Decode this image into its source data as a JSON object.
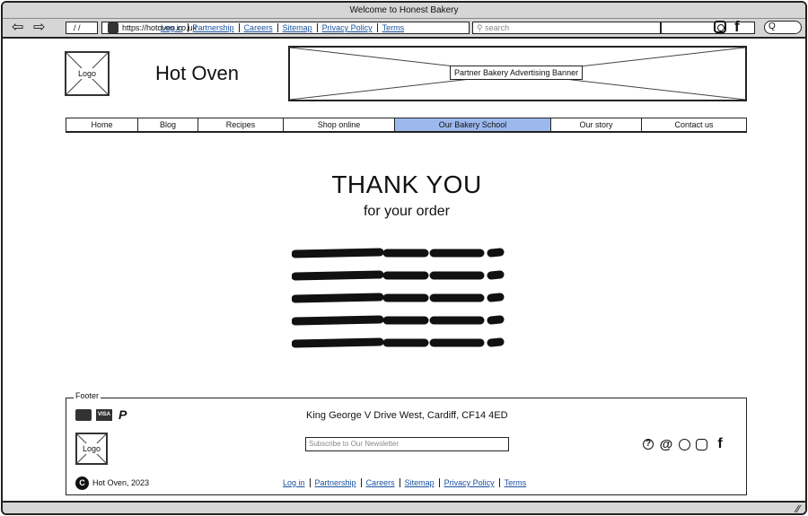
{
  "window": {
    "title": "Welcome to Honest Bakery"
  },
  "toolbar": {
    "back_icon": "back-arrow-icon",
    "forward_icon": "forward-arrow-icon",
    "path": "/ /",
    "url": "https://hotoven.co.uk",
    "links": [
      "Log in",
      "Partnership",
      "Careers",
      "Sitemap",
      "Privacy Policy",
      "Terms"
    ],
    "search_placeholder": "search",
    "search_pill": "Q"
  },
  "header": {
    "logo_label": "Logo",
    "brand": "Hot Oven",
    "banner_label": "Partner Bakery Advertising Banner"
  },
  "nav": {
    "items": [
      "Home",
      "Blog",
      "Recipes",
      "Shop online",
      "Our Bakery School",
      "Our story",
      "Contact us"
    ],
    "active": "Our Bakery School",
    "active_color": "#9db8ec"
  },
  "main": {
    "title": "THANK YOU",
    "subtitle": "for your order",
    "scribble_lines": 5
  },
  "footer": {
    "legend": "Footer",
    "payments": [
      "mastercard-icon",
      "visa-icon",
      "paypal-icon"
    ],
    "visa_label": "VISA",
    "address": "King George V Drive West, Cardiff, CF14 4ED",
    "logo_label": "Logo",
    "newsletter_placeholder": "Subscribe to Our Newsletter",
    "copyright_mark": "C",
    "copyright": "Hot Oven, 2023",
    "links": [
      "Log in",
      "Partnership",
      "Careers",
      "Sitemap",
      "Privacy Policy",
      "Terms"
    ],
    "social_icons": [
      "help-icon",
      "email-icon",
      "whatsapp-icon",
      "instagram-icon",
      "facebook-icon"
    ]
  }
}
